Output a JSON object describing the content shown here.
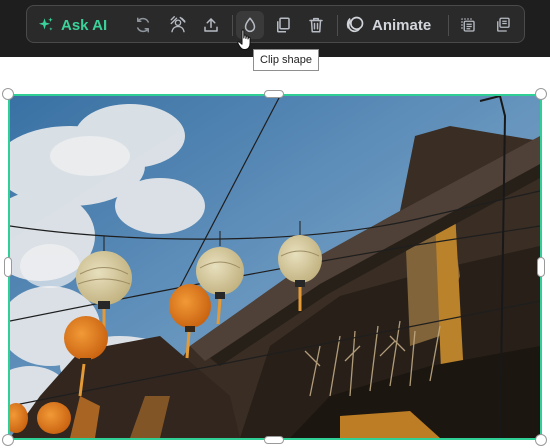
{
  "toolbar": {
    "ask_ai_label": "Ask AI",
    "animate_label": "Animate",
    "icons": [
      "sparkle-icon",
      "refresh-icon",
      "remove-background-icon",
      "upload-icon",
      "clip-shape-icon",
      "duplicate-icon",
      "trash-icon",
      "animate-icon",
      "crop-frame-icon",
      "layers-icon"
    ]
  },
  "tooltip": {
    "text": "Clip shape"
  },
  "colors": {
    "accent": "#2fcf96",
    "ask_ai": "#3bd29a",
    "toolbar_bg": "#2a2a2a",
    "band_bg": "#1e1e1e"
  },
  "image": {
    "subject": "photo-hanging-lanterns"
  }
}
